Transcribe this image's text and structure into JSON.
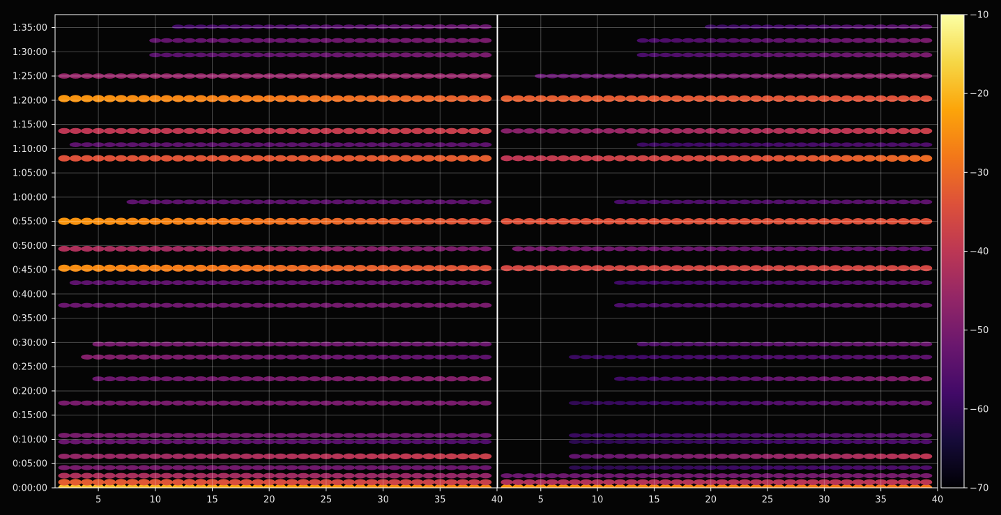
{
  "chart_data": {
    "type": "heatmap",
    "title": "",
    "xlabel": "",
    "ylabel": "",
    "background": "#050505",
    "grid": true,
    "panels": [
      {
        "name": "left",
        "xlim": [
          1.2,
          40
        ],
        "xticks": [
          5,
          10,
          15,
          20,
          25,
          30,
          35,
          40
        ],
        "xtick_labels": [
          "5",
          "10",
          "15",
          "20",
          "25",
          "30",
          "35",
          "40"
        ]
      },
      {
        "name": "right",
        "xlim": [
          1.2,
          40
        ],
        "xticks": [
          5,
          10,
          15,
          20,
          25,
          30,
          35,
          40
        ],
        "xtick_labels": [
          "5",
          "10",
          "15",
          "20",
          "25",
          "30",
          "35",
          "40"
        ]
      }
    ],
    "y_axis": {
      "unit": "seconds",
      "ylim": [
        0,
        5860
      ],
      "ticks": [
        0,
        300,
        600,
        900,
        1200,
        1500,
        1800,
        2100,
        2400,
        2700,
        3000,
        3300,
        3600,
        3900,
        4200,
        4500,
        4800,
        5100,
        5400,
        5700
      ],
      "tick_labels": [
        "0:00:00",
        "0:05:00",
        "0:10:00",
        "0:15:00",
        "0:20:00",
        "0:25:00",
        "0:30:00",
        "0:35:00",
        "0:40:00",
        "0:45:00",
        "0:50:00",
        "0:55:00",
        "1:00:00",
        "1:05:00",
        "1:10:00",
        "1:15:00",
        "1:20:00",
        "1:25:00",
        "1:30:00",
        "1:35:00"
      ]
    },
    "colorbar": {
      "colormap": "inferno",
      "range": [
        -70,
        -10
      ],
      "ticks": [
        -70,
        -60,
        -50,
        -40,
        -30,
        -20,
        -10
      ],
      "tick_labels": [
        "−70",
        "−60",
        "−50",
        "−40",
        "−30",
        "−20",
        "−10"
      ]
    },
    "bands": [
      {
        "t": 0,
        "left": [
          -18,
          -26
        ],
        "right": [
          -24,
          -28
        ],
        "x_left": [
          2,
          39
        ],
        "x_right": [
          2,
          39
        ]
      },
      {
        "t": 70,
        "left": [
          -32,
          -38
        ],
        "right": [
          -42,
          -40
        ],
        "x_left": [
          2,
          39
        ],
        "x_right": [
          2,
          39
        ]
      },
      {
        "t": 150,
        "left": [
          -42,
          -46
        ],
        "right": [
          -52,
          -50
        ],
        "x_left": [
          2,
          39
        ],
        "x_right": [
          2,
          39
        ]
      },
      {
        "t": 250,
        "left": [
          -50,
          -52
        ],
        "right": [
          -62,
          -56
        ],
        "x_left": [
          2,
          39
        ],
        "x_right": [
          8,
          39
        ]
      },
      {
        "t": 390,
        "left": [
          -46,
          -38
        ],
        "right": [
          -56,
          -40
        ],
        "x_left": [
          2,
          39
        ],
        "x_right": [
          8,
          39
        ]
      },
      {
        "t": 570,
        "left": [
          -52,
          -56
        ],
        "right": [
          -62,
          -56
        ],
        "x_left": [
          2,
          39
        ],
        "x_right": [
          8,
          39
        ]
      },
      {
        "t": 650,
        "left": [
          -50,
          -52
        ],
        "right": [
          -60,
          -54
        ],
        "x_left": [
          2,
          39
        ],
        "x_right": [
          8,
          39
        ]
      },
      {
        "t": 1050,
        "left": [
          -50,
          -50
        ],
        "right": [
          -62,
          -52
        ],
        "x_left": [
          2,
          39
        ],
        "x_right": [
          8,
          39
        ]
      },
      {
        "t": 1350,
        "left": [
          -52,
          -48
        ],
        "right": [
          -62,
          -48
        ],
        "x_left": [
          5,
          39
        ],
        "x_right": [
          12,
          39
        ]
      },
      {
        "t": 1620,
        "left": [
          -48,
          -54
        ],
        "right": [
          -60,
          -54
        ],
        "x_left": [
          4,
          39
        ],
        "x_right": [
          8,
          39
        ]
      },
      {
        "t": 1780,
        "left": [
          -50,
          -52
        ],
        "right": [
          -58,
          -52
        ],
        "x_left": [
          5,
          39
        ],
        "x_right": [
          14,
          39
        ]
      },
      {
        "t": 2260,
        "left": [
          -52,
          -50
        ],
        "right": [
          -58,
          -52
        ],
        "x_left": [
          2,
          39
        ],
        "x_right": [
          12,
          39
        ]
      },
      {
        "t": 2540,
        "left": [
          -54,
          -52
        ],
        "right": [
          -60,
          -54
        ],
        "x_left": [
          3,
          39
        ],
        "x_right": [
          12,
          39
        ]
      },
      {
        "t": 2720,
        "left": [
          -25,
          -34
        ],
        "right": [
          -36,
          -36
        ],
        "x_left": [
          2,
          39
        ],
        "x_right": [
          2,
          39
        ]
      },
      {
        "t": 2960,
        "left": [
          -42,
          -50
        ],
        "right": [
          -50,
          -54
        ],
        "x_left": [
          2,
          39
        ],
        "x_right": [
          3,
          39
        ]
      },
      {
        "t": 3300,
        "left": [
          -24,
          -34
        ],
        "right": [
          -34,
          -34
        ],
        "x_left": [
          2,
          39
        ],
        "x_right": [
          2,
          39
        ]
      },
      {
        "t": 3540,
        "left": [
          -54,
          -54
        ],
        "right": [
          -58,
          -54
        ],
        "x_left": [
          8,
          39
        ],
        "x_right": [
          12,
          39
        ]
      },
      {
        "t": 4080,
        "left": [
          -34,
          -32
        ],
        "right": [
          -40,
          -30
        ],
        "x_left": [
          2,
          39
        ],
        "x_right": [
          2,
          39
        ]
      },
      {
        "t": 4250,
        "left": [
          -54,
          -54
        ],
        "right": [
          -60,
          -56
        ],
        "x_left": [
          3,
          39
        ],
        "x_right": [
          14,
          39
        ]
      },
      {
        "t": 4420,
        "left": [
          -40,
          -38
        ],
        "right": [
          -48,
          -38
        ],
        "x_left": [
          2,
          39
        ],
        "x_right": [
          2,
          39
        ]
      },
      {
        "t": 4820,
        "left": [
          -24,
          -32
        ],
        "right": [
          -32,
          -34
        ],
        "x_left": [
          2,
          39
        ],
        "x_right": [
          2,
          39
        ]
      },
      {
        "t": 5100,
        "left": [
          -46,
          -46
        ],
        "right": [
          -54,
          -46
        ],
        "x_left": [
          2,
          39
        ],
        "x_right": [
          5,
          39
        ]
      },
      {
        "t": 5360,
        "left": [
          -56,
          -50
        ],
        "right": [
          -60,
          -50
        ],
        "x_left": [
          10,
          39
        ],
        "x_right": [
          14,
          39
        ]
      },
      {
        "t": 5540,
        "left": [
          -54,
          -50
        ],
        "right": [
          -60,
          -50
        ],
        "x_left": [
          10,
          39
        ],
        "x_right": [
          14,
          39
        ]
      },
      {
        "t": 5710,
        "left": [
          -60,
          -52
        ],
        "right": [
          -64,
          -54
        ],
        "x_left": [
          12,
          39
        ],
        "x_right": [
          20,
          39
        ]
      }
    ]
  }
}
